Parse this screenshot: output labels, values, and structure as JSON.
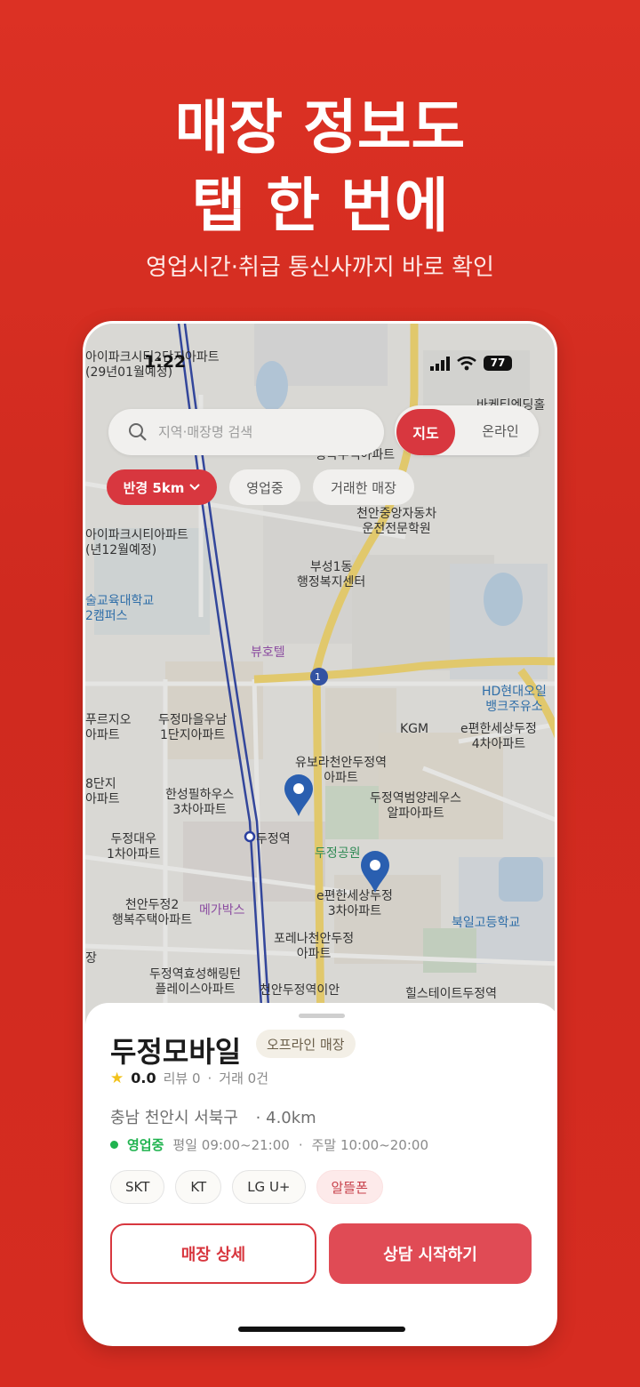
{
  "promo": {
    "headline_line1": "매장 정보도",
    "headline_line2": "탭 한 번에",
    "subline": "영업시간·취급 통신사까지 바로 확인"
  },
  "status_bar": {
    "time": "1:22",
    "battery": "77"
  },
  "search": {
    "placeholder": "지역·매장명 검색"
  },
  "view_toggle": {
    "map_label": "지도",
    "online_label": "온라인",
    "selected": "지도"
  },
  "filters": {
    "radius_label": "반경 5km",
    "open_label": "영업중",
    "traded_label": "거래한 매장"
  },
  "map_labels": {
    "apt_top_1": "아이파크시티2단지아파트",
    "apt_top_2": "(29년01월예정)",
    "biketem": "바케티엔딩홀",
    "haengbok": "행복주택아파트",
    "driving_school_1": "천안중앙자동차",
    "driving_school_2": "운전전문학원",
    "apt_left_1": "아이파크시티아파트",
    "apt_left_2": "(년12월예정)",
    "welfare_1": "부성1동",
    "welfare_2": "행정복지센터",
    "univ_1": "술교육대학교",
    "univ_2": "2캠퍼스",
    "hotel": "뷰호텔",
    "road_no": "1",
    "hd_1": "HD현대오일",
    "hd_2": "뱅크주유소",
    "prugio_1": "푸르지오",
    "prugio_2": "아파트",
    "maeul_1": "두정마을우남",
    "maeul_2": "1단지아파트",
    "kgm": "KGM",
    "e_pyeon_1": "e편한세상두정",
    "e_pyeon_2": "4차아파트",
    "yubora_1": "유보라천안두정역",
    "yubora_2": "아파트",
    "eight_1": "8단지",
    "eight_2": "아파트",
    "hanseong_1": "한성필하우스",
    "hanseong_2": "3차아파트",
    "beomyang_1": "두정역범양레우스",
    "beomyang_2": "알파아파트",
    "daewoo_1": "두정대우",
    "daewoo_2": "1차아파트",
    "station": "두정역",
    "park": "두정공원",
    "e_pyeon3_1": "e편한세상두정",
    "e_pyeon3_2": "3차아파트",
    "cheonan2_1": "천안두정2",
    "cheonan2_2": "행복주택아파트",
    "megabox": "메가박스",
    "bugil": "북일고등학교",
    "jang": "장",
    "porena_1": "포레나천안두정",
    "porena_2": "아파트",
    "hyoseong_1": "두정역효성해링턴",
    "hyoseong_2": "플레이스아파트",
    "ian": "천안두정역이안",
    "hills": "힐스테이트두정역"
  },
  "store": {
    "name": "두정모바일",
    "type_badge": "오프라인 매장",
    "rating": "0.0",
    "reviews": "리뷰 0",
    "separator": "·",
    "trades": "거래 0건",
    "address": "충남 천안시 서북구",
    "distance": "· 4.0km",
    "open_status": "영업중",
    "weekday_hours": "평일 09:00~21:00",
    "weekend_hours": "주말 10:00~20:00",
    "carriers": [
      "SKT",
      "KT",
      "LG U+",
      "알뜰폰"
    ],
    "detail_button": "매장 상세",
    "consult_button": "상담 시작하기"
  },
  "colors": {
    "brand_red": "#d8373f",
    "background_red": "#d42b20",
    "open_green": "#20b34f"
  }
}
